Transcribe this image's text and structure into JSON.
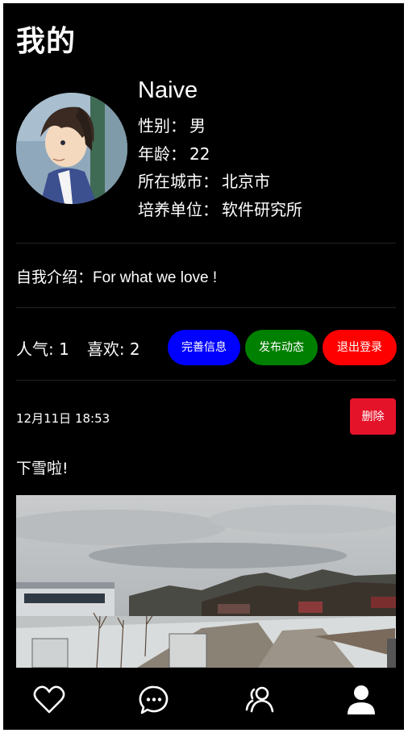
{
  "header": {
    "title": "我的"
  },
  "profile": {
    "username": "Naive",
    "gender_label": "性别：",
    "gender_value": "男",
    "age_label": "年龄：",
    "age_value": "22",
    "city_label": "所在城市：",
    "city_value": "北京市",
    "org_label": "培养单位：",
    "org_value": "软件研究所"
  },
  "intro": {
    "label": "自我介绍：",
    "value": "For what we love !"
  },
  "stats": {
    "popularity": "人气: 1",
    "likes": "喜欢: 2"
  },
  "actions": {
    "edit_label": "完善信息",
    "post_label": "发布动态",
    "logout_label": "退出登录"
  },
  "colors": {
    "background": "#000000",
    "edit_button": "#0000ff",
    "post_button": "#008000",
    "logout_button": "#ff0000",
    "delete_button": "#e5132a"
  },
  "post": {
    "timestamp": "12月11日 18:53",
    "delete_label": "删除",
    "text": "下雪啦!"
  },
  "tabbar": {
    "icons": [
      "heart-icon",
      "chat-bubble-icon",
      "friends-icon",
      "user-icon"
    ]
  }
}
